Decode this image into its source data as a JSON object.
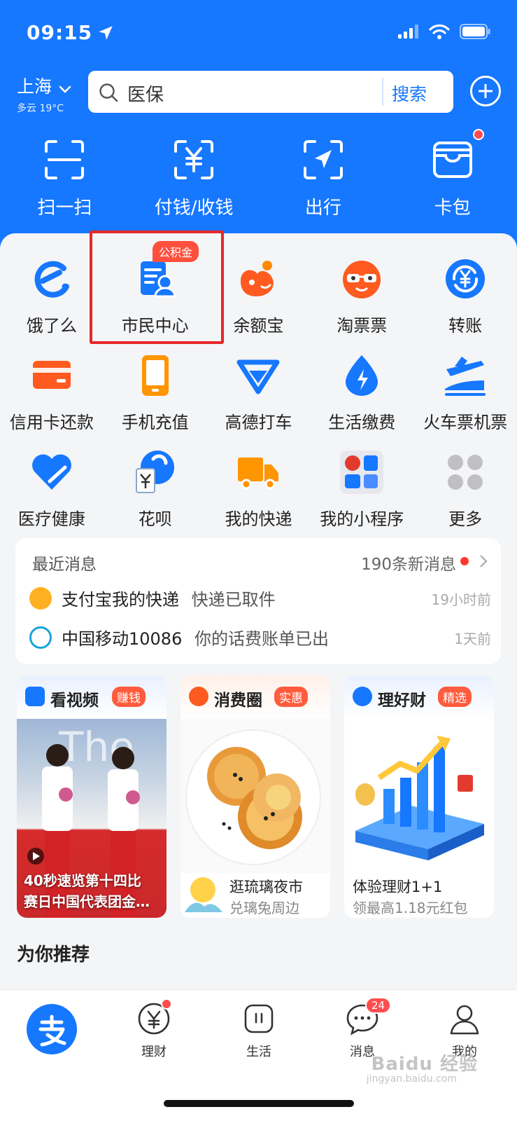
{
  "status_bar": {
    "time": "09:15"
  },
  "header": {
    "city": "上海",
    "weather": "多云 19°C",
    "search_text": "医保",
    "search_button": "搜索"
  },
  "quick_actions": [
    {
      "label": "扫一扫",
      "icon": "scan-icon"
    },
    {
      "label": "付钱/收钱",
      "icon": "pay-receive-icon"
    },
    {
      "label": "出行",
      "icon": "travel-icon"
    },
    {
      "label": "卡包",
      "icon": "wallet-icon"
    }
  ],
  "services": [
    {
      "label": "饿了么",
      "icon": "eleme-icon"
    },
    {
      "label": "市民中心",
      "icon": "citizen-center-icon",
      "badge": "公积金"
    },
    {
      "label": "余额宝",
      "icon": "yuebao-icon"
    },
    {
      "label": "淘票票",
      "icon": "taopiaopiao-icon"
    },
    {
      "label": "转账",
      "icon": "transfer-icon"
    },
    {
      "label": "信用卡还款",
      "icon": "credit-card-icon"
    },
    {
      "label": "手机充值",
      "icon": "phone-recharge-icon"
    },
    {
      "label": "高德打车",
      "icon": "gaode-taxi-icon"
    },
    {
      "label": "生活缴费",
      "icon": "utility-bill-icon"
    },
    {
      "label": "火车票机票",
      "icon": "train-plane-icon"
    },
    {
      "label": "医疗健康",
      "icon": "health-icon"
    },
    {
      "label": "花呗",
      "icon": "huabei-icon"
    },
    {
      "label": "我的快递",
      "icon": "delivery-truck-icon"
    },
    {
      "label": "我的小程序",
      "icon": "mini-programs-icon"
    },
    {
      "label": "更多",
      "icon": "more-icon"
    }
  ],
  "messages": {
    "title": "最近消息",
    "count": "190条新消息",
    "items": [
      {
        "source": "支付宝我的快递",
        "text": "快递已取件",
        "time": "19小时前"
      },
      {
        "source": "中国移动10086",
        "text": "你的话费账单已出",
        "time": "1天前"
      }
    ]
  },
  "feature_cards": [
    {
      "title": "看视频",
      "tag": "赚钱",
      "line1": "40秒速览第十四比",
      "line2": "赛日中国代表团金…"
    },
    {
      "title": "消费圈",
      "tag": "实惠",
      "line1": "逛琉璃夜市",
      "line2": "兑璃兔周边"
    },
    {
      "title": "理好财",
      "tag": "精选",
      "line1": "体验理财1+1",
      "line2": "领最高1.18元红包"
    }
  ],
  "recommend_title": "为你推荐",
  "tabbar": [
    {
      "label": "理财"
    },
    {
      "label": "生活"
    },
    {
      "label": "消息",
      "badge": "24"
    },
    {
      "label": "我的"
    }
  ],
  "watermark": {
    "text": "Baidu 经验",
    "sub": "jingyan.baidu.com"
  },
  "colors": {
    "brand_blue": "#1677ff",
    "highlight_red": "#e5282a",
    "badge_red": "#ff4f3d"
  }
}
